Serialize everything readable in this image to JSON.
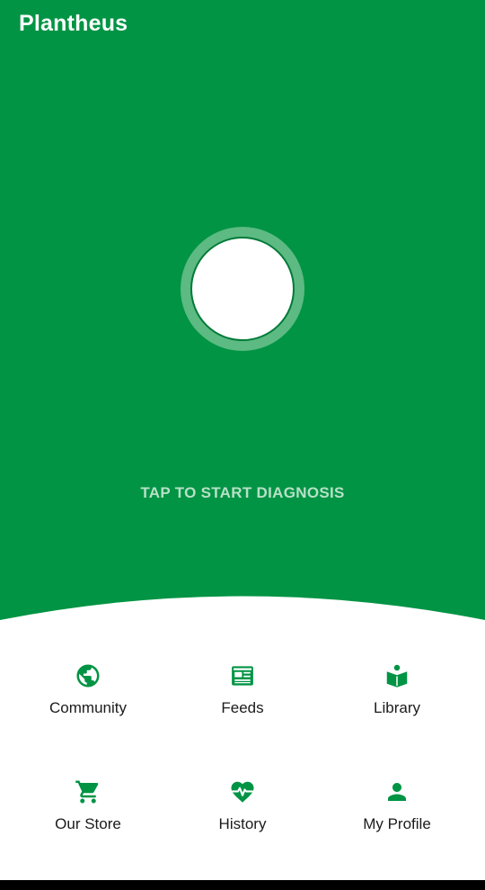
{
  "app": {
    "title": "Plantheus",
    "brand_color": "#009444",
    "cta": "TAP TO START DIAGNOSIS"
  },
  "menu": {
    "items": [
      {
        "label": "Community",
        "icon": "globe-icon"
      },
      {
        "label": "Feeds",
        "icon": "newspaper-icon"
      },
      {
        "label": "Library",
        "icon": "book-reader-icon"
      },
      {
        "label": "Our Store",
        "icon": "cart-icon"
      },
      {
        "label": "History",
        "icon": "heart-pulse-icon"
      },
      {
        "label": "My Profile",
        "icon": "person-icon"
      }
    ]
  }
}
